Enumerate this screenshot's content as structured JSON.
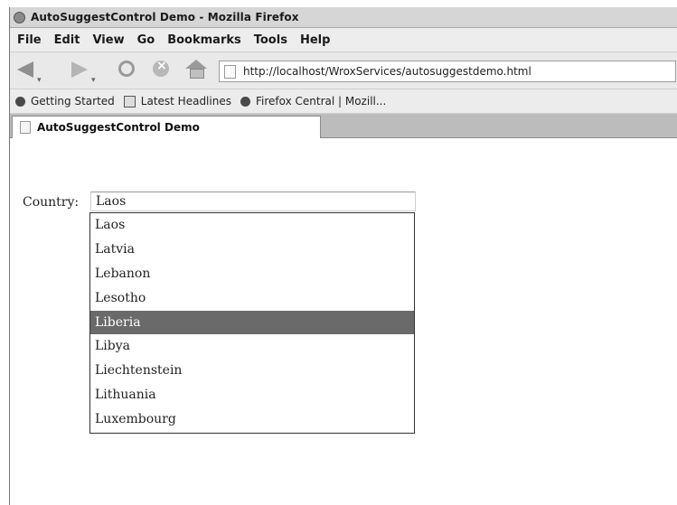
{
  "window": {
    "title": "AutoSuggestControl Demo - Mozilla Firefox"
  },
  "menu": [
    "File",
    "Edit",
    "View",
    "Go",
    "Bookmarks",
    "Tools",
    "Help"
  ],
  "nav": {
    "url": "http://localhost/WroxServices/autosuggestdemo.html"
  },
  "bookmarks": [
    "Getting Started",
    "Latest Headlines",
    "Firefox Central | Mozill..."
  ],
  "tab": {
    "label": "AutoSuggestControl Demo"
  },
  "form": {
    "label": "Country:",
    "value": "Laos"
  },
  "suggestions": [
    "Laos",
    "Latvia",
    "Lebanon",
    "Lesotho",
    "Liberia",
    "Libya",
    "Liechtenstein",
    "Lithuania",
    "Luxembourg"
  ],
  "selected_index": 4
}
